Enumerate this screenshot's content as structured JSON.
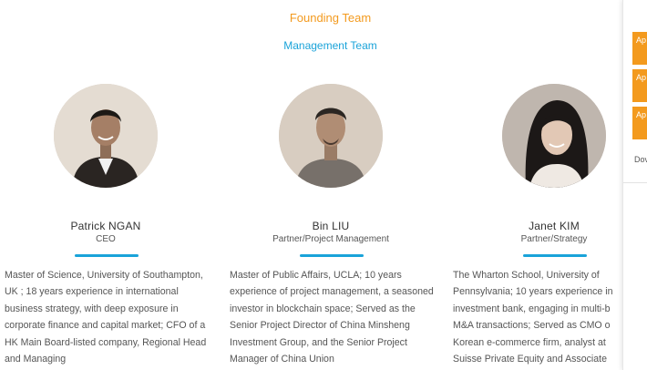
{
  "headings": {
    "founding": "Founding Team",
    "management": "Management Team"
  },
  "members": [
    {
      "name": "Patrick NGAN",
      "role": "CEO",
      "bio": "Master of Science, University of Southampton, UK ; 18 years experience in international business strategy, with deep exposure in corporate finance and capital market; CFO of a HK Main Board-listed company, Regional Head and Managing"
    },
    {
      "name": "Bin LIU",
      "role": "Partner/Project Management",
      "bio": "Master of Public Affairs, UCLA; 10 years experience of project management, a seasoned investor in blockchain space; Served as the Senior Project Director of China Minsheng Investment Group, and the Senior Project Manager of China Union"
    },
    {
      "name": "Janet KIM",
      "role": "Partner/Strategy",
      "bio": "The Wharton School, University of Pennsylvania; 10 years experience in investment bank, engaging in multi-b M&A transactions; Served as CMO o Korean e-commerce firm, analyst at Suisse Private Equity and Associate"
    }
  ],
  "side_panel": {
    "buttons": [
      "Ap me",
      "Ap ac",
      "Ap de"
    ],
    "download": "Dov"
  },
  "colors": {
    "accent_orange": "#f39a1e",
    "accent_blue": "#1aa3d9"
  }
}
